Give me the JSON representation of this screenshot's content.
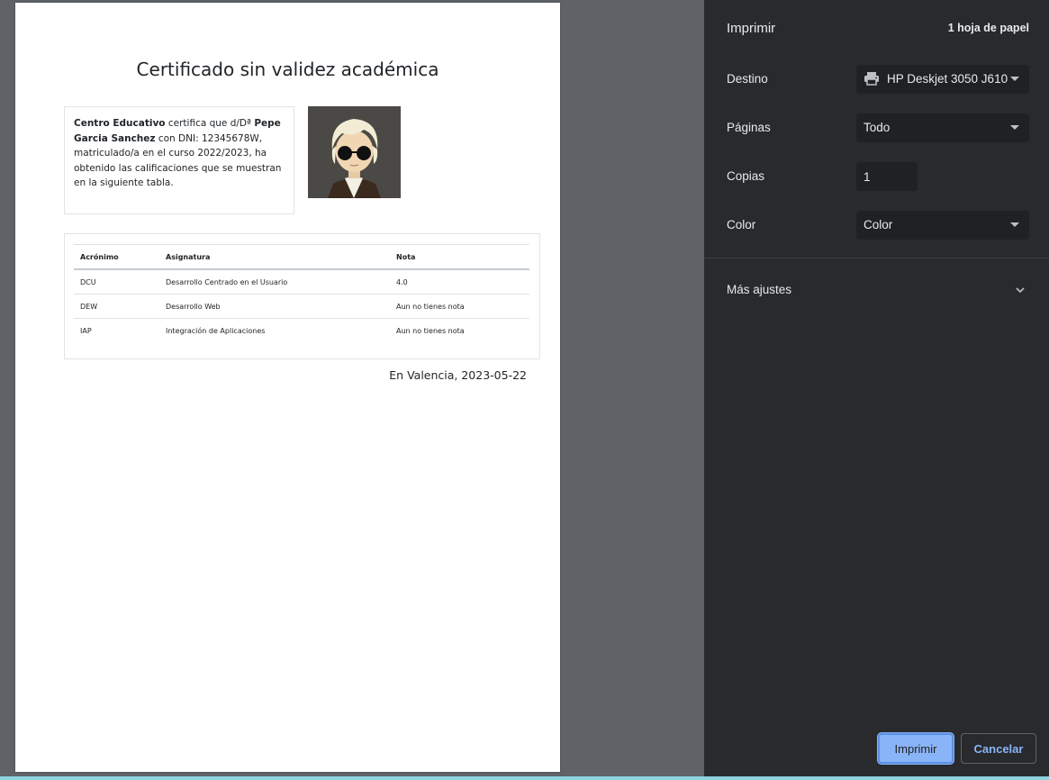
{
  "certificate": {
    "title": "Certificado sin validez académica",
    "intro": {
      "institution": "Centro Educativo",
      "text1": " certifica que d/Dª ",
      "student_name": "Pepe Garcia Sanchez",
      "text2": " con DNI: 12345678W, matriculado/a en el curso 2022/2023, ha obtenido las calificaciones que se muestran en la siguiente tabla."
    },
    "table": {
      "headers": [
        "Acrónimo",
        "Asignatura",
        "Nota"
      ],
      "rows": [
        [
          "DCU",
          "Desarrollo Centrado en el Usuario",
          "4.0"
        ],
        [
          "DEW",
          "Desarrollo Web",
          "Aun no tienes nota"
        ],
        [
          "IAP",
          "Integración de Aplicaciones",
          "Aun no tienes nota"
        ]
      ]
    },
    "place_date": "En Valencia, 2023-05-22"
  },
  "print_dialog": {
    "title": "Imprimir",
    "sheet_count": "1 hoja de papel",
    "destination_label": "Destino",
    "destination_value": "HP Deskjet 3050 J610",
    "pages_label": "Páginas",
    "pages_value": "Todo",
    "copies_label": "Copias",
    "copies_value": "1",
    "color_label": "Color",
    "color_value": "Color",
    "more_settings_label": "Más ajustes",
    "print_button": "Imprimir",
    "cancel_button": "Cancelar"
  },
  "colors": {
    "panel_bg": "#292a2d",
    "accent": "#8ab4f8",
    "preview_bg": "#5f6368"
  },
  "icons": [
    "printer-icon",
    "chevron-down-icon",
    "dropdown-caret-icon"
  ]
}
